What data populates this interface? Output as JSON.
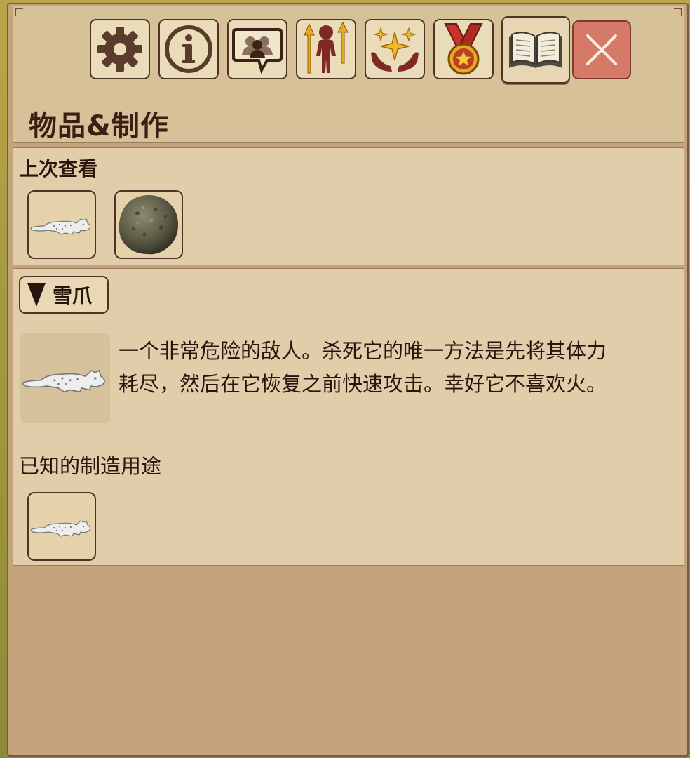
{
  "window": {
    "title": "物品&制作"
  },
  "tabs": [
    {
      "name": "settings",
      "icon": "gear-icon"
    },
    {
      "name": "info",
      "icon": "info-icon"
    },
    {
      "name": "social",
      "icon": "people-chat-icon"
    },
    {
      "name": "character",
      "icon": "character-stats-icon"
    },
    {
      "name": "skills",
      "icon": "sparkle-hands-icon"
    },
    {
      "name": "achievements",
      "icon": "medal-icon"
    },
    {
      "name": "encyclopedia",
      "icon": "open-book-icon",
      "active": true
    },
    {
      "name": "close",
      "icon": "close-icon"
    }
  ],
  "recent": {
    "title": "上次查看",
    "items": [
      {
        "icon": "snow-leopard-icon"
      },
      {
        "icon": "stone-ball-icon"
      }
    ]
  },
  "detail": {
    "toggle_label": "雪爪",
    "image_icon": "snow-leopard-icon",
    "description": "一个非常危险的敌人。杀死它的唯一方法是先将其体力耗尽，然后在它恢复之前快速攻击。幸好它不喜欢火。",
    "uses_label": "已知的制造用途",
    "uses": [
      {
        "icon": "snow-leopard-icon"
      }
    ]
  },
  "colors": {
    "panel_bg": "#e0ceaa",
    "window_bg": "#c4a47c",
    "text": "#2a140e",
    "close_button": "#d57a66",
    "icon_brown": "#5a3c2c",
    "icon_red": "#7c2a22",
    "icon_gold": "#e8a91c"
  }
}
